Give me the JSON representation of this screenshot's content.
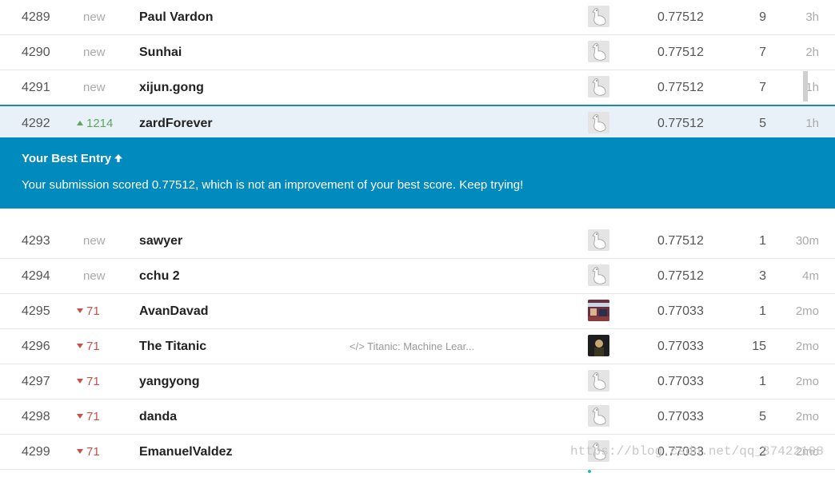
{
  "rows_top": [
    {
      "rank": "4289",
      "change_type": "new",
      "change": "new",
      "name": "Paul Vardon",
      "kernel": "",
      "avatar": "goose-avatar",
      "score": "0.77512",
      "entries": "9",
      "last": "3h",
      "dots": 1
    },
    {
      "rank": "4290",
      "change_type": "new",
      "change": "new",
      "name": "Sunhai",
      "kernel": "",
      "avatar": "goose-avatar",
      "score": "0.77512",
      "entries": "7",
      "last": "2h",
      "dots": 1
    },
    {
      "rank": "4291",
      "change_type": "new",
      "change": "new",
      "name": "xijun.gong",
      "kernel": "",
      "avatar": "goose-avatar",
      "score": "0.77512",
      "entries": "7",
      "last": "1h",
      "dots": 1
    },
    {
      "rank": "4292",
      "change_type": "up",
      "change": "1214",
      "name": "zardForever",
      "kernel": "",
      "avatar": "goose-avatar",
      "score": "0.77512",
      "entries": "5",
      "last": "1h",
      "dots": 1,
      "mine": true
    }
  ],
  "banner": {
    "title": "Your Best Entry",
    "message": "Your submission scored 0.77512, which is not an improvement of your best score. Keep trying!"
  },
  "rows_bottom": [
    {
      "rank": "4293",
      "change_type": "new",
      "change": "new",
      "name": "sawyer",
      "kernel": "",
      "avatar": "goose-avatar",
      "score": "0.77512",
      "entries": "1",
      "last": "30m",
      "dots": 1
    },
    {
      "rank": "4294",
      "change_type": "new",
      "change": "new",
      "name": "cchu 2",
      "kernel": "",
      "avatar": "goose-avatar",
      "score": "0.77512",
      "entries": "3",
      "last": "4m",
      "dots": 1
    },
    {
      "rank": "4295",
      "change_type": "down",
      "change": "71",
      "name": "AvanDavad",
      "kernel": "",
      "avatar": "photo-avatar",
      "score": "0.77033",
      "entries": "1",
      "last": "2mo",
      "dots": 1
    },
    {
      "rank": "4296",
      "change_type": "down",
      "change": "71",
      "name": "The Titanic",
      "kernel": "</> Titanic: Machine Lear...",
      "avatar": "dark-avatar",
      "score": "0.77033",
      "entries": "15",
      "last": "2mo",
      "dots": 2
    },
    {
      "rank": "4297",
      "change_type": "down",
      "change": "71",
      "name": "yangyong",
      "kernel": "",
      "avatar": "goose-avatar",
      "score": "0.77033",
      "entries": "1",
      "last": "2mo",
      "dots": 1
    },
    {
      "rank": "4298",
      "change_type": "down",
      "change": "71",
      "name": "danda",
      "kernel": "",
      "avatar": "goose-avatar",
      "score": "0.77033",
      "entries": "5",
      "last": "2mo",
      "dots": 1
    },
    {
      "rank": "4299",
      "change_type": "down",
      "change": "71",
      "name": "EmanuelValdez",
      "kernel": "",
      "avatar": "goose-avatar",
      "score": "0.77033",
      "entries": "2",
      "last": "2mo",
      "dots": 1
    }
  ],
  "watermark": "https://blog.csdn.net/qq_37422108",
  "colors": {
    "banner": "#008abd",
    "up": "#5aa85a",
    "down": "#c9504a",
    "highlight_row": "#e8f1f7",
    "accent_border": "#1a88bd",
    "dot": "#20beb4"
  }
}
